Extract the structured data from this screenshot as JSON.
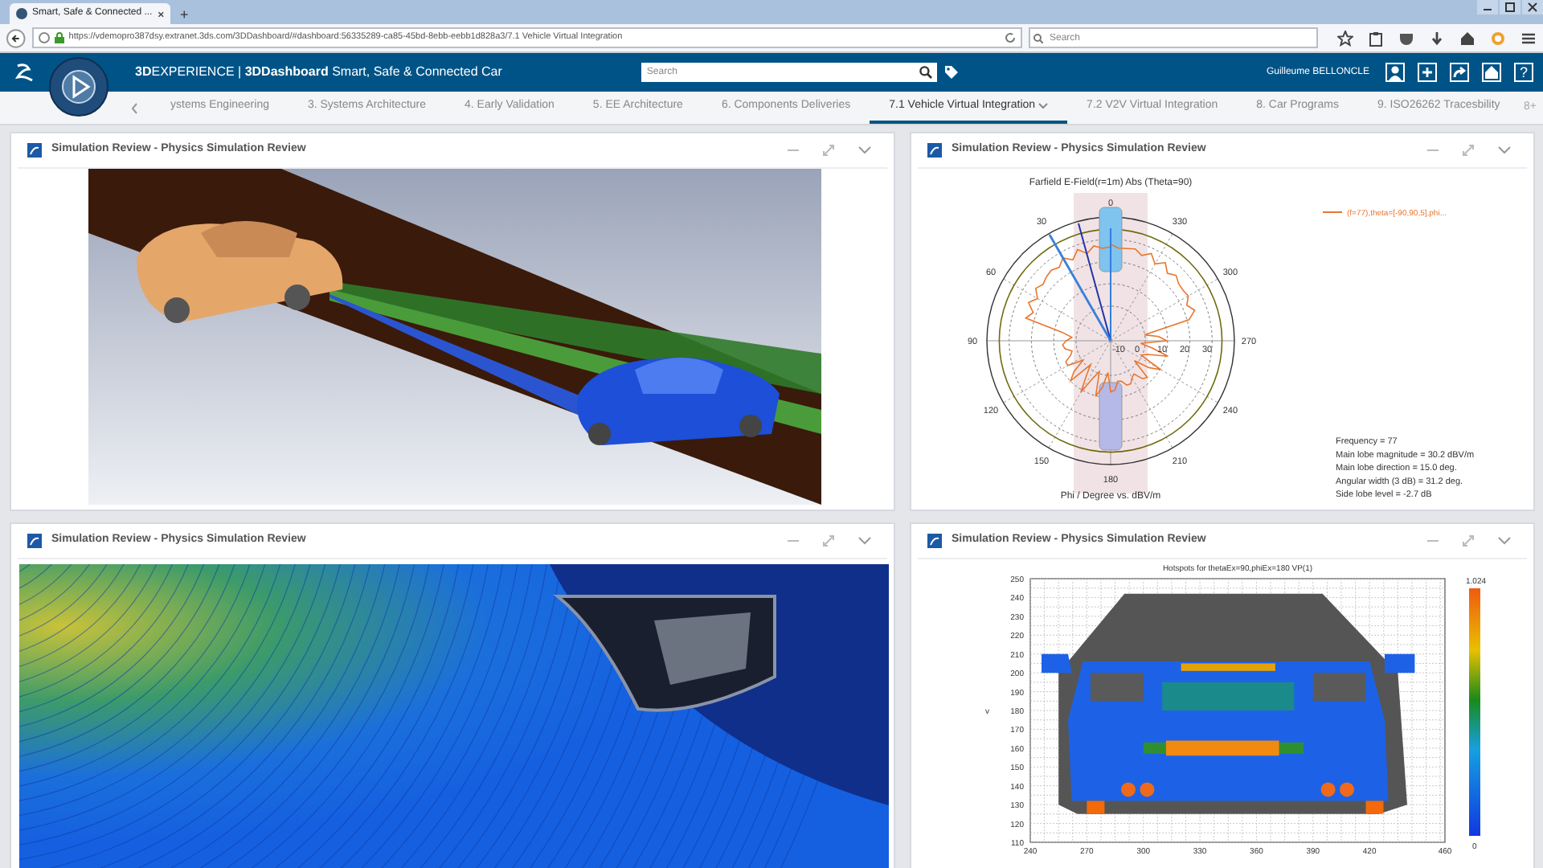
{
  "browser": {
    "tab_title": "Smart, Safe & Connected ...",
    "new_tab": "+",
    "url": "https://vdemopro387dsy.extranet.3ds.com/3DDashboard/#dashboard:56335289-ca85-45bd-8ebb-eebb1d828a3/7.1 Vehicle Virtual Integration",
    "search_placeholder": "Search"
  },
  "app": {
    "brand": "**3D**EXPERIENCE | **3DDashboard** Smart, Safe & Connected Car",
    "search_placeholder": "Search",
    "user": "Guilleume BELLONCLE",
    "help": "?"
  },
  "tabs": [
    {
      "label": "ystems Engineering",
      "selected": false
    },
    {
      "label": "3. Systems Architecture",
      "selected": false
    },
    {
      "label": "4. Early Validation",
      "selected": false
    },
    {
      "label": "5. EE Architecture",
      "selected": false
    },
    {
      "label": "6. Components Deliveries",
      "selected": false
    },
    {
      "label": "7.1 Vehicle Virtual Integration",
      "selected": true
    },
    {
      "label": "7.2 V2V Virtual Integration",
      "selected": false
    },
    {
      "label": "8. Car Programs",
      "selected": false
    },
    {
      "label": "9. ISO26262 Tracesbility",
      "selected": false
    }
  ],
  "tabs_more": "8+",
  "panels": [
    {
      "title": "Simulation Review - Physics Simulation Review",
      "kind": "cars"
    },
    {
      "title": "Simulation Review - Physics Simulation Review",
      "kind": "polar",
      "plot_title": "Farfield E-Field(r=1m) Abs (Theta=90)",
      "legend": "(f=77),theta=[-90,90,5],phi...",
      "angle_labels": [
        "0",
        "30",
        "60",
        "90",
        "120",
        "150",
        "180",
        "210",
        "240",
        "270",
        "300",
        "330"
      ],
      "radial_labels": [
        "-10",
        "0",
        "10",
        "20",
        "30"
      ],
      "xlabel": "Phi / Degree vs. dBV/m",
      "stats": [
        "Frequency = 77",
        "Main lobe magnitude =     30.2 dBV/m",
        "Main lobe direction =   15.0 deg.",
        "Angular width (3 dB) =   31.2 deg.",
        "Side lobe level =   -2.7 dB"
      ]
    },
    {
      "title": "Simulation Review - Physics Simulation Review",
      "kind": "field"
    },
    {
      "title": "Simulation Review - Physics Simulation Review",
      "kind": "heatmap",
      "plot_title": "Hotspots for thetaEx=90,phiEx=180 VP(1)",
      "yticks": [
        "250",
        "240",
        "230",
        "220",
        "210",
        "200",
        "190",
        "180",
        "170",
        "160",
        "150",
        "140",
        "130",
        "120",
        "110"
      ],
      "xticks": [
        "240",
        "270",
        "300",
        "330",
        "360",
        "390",
        "420",
        "460"
      ],
      "ylabel": "v",
      "colorbar_max": "1.024",
      "colorbar_min": "0"
    }
  ]
}
